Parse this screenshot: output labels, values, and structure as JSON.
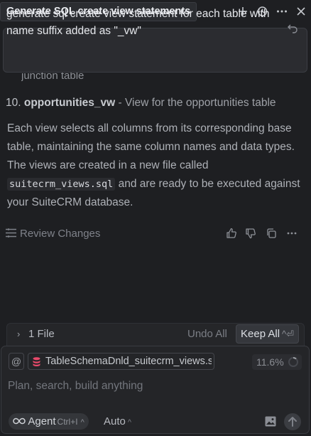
{
  "header": {
    "tab_title": "Generate SQL create view statements",
    "icons": [
      "plus-icon",
      "history-icon",
      "more-icon",
      "close-icon"
    ]
  },
  "prompt": {
    "text": "generate sql create view statement for each table with name suffix added as \"_vw\""
  },
  "transcript": {
    "cut_line": "junction table",
    "list_item": {
      "number": "10.",
      "name": "opportunities_vw",
      "description": " - View for the opportunities table"
    },
    "paragraph": {
      "part1": "Each view selects all columns from its corresponding base table, maintaining the same column names and data types. The views are created in a new file called ",
      "code": "suitecrm_views.sql",
      "part2": " and are ready to be executed against your SuiteCRM database."
    },
    "review_label": "Review Changes"
  },
  "files_bar": {
    "label": "1 File",
    "undo_all": "Undo All",
    "keep_all": "Keep All",
    "keep_all_shortcut": "^⏎"
  },
  "composer": {
    "at_symbol": "@",
    "context_file": "TableSchemaDnld_suitecrm_views.sql",
    "context_usage": "11.6%",
    "context_usage_fraction": 0.116,
    "placeholder": "Plan, search, build anything",
    "agent_label": "Agent",
    "agent_shortcut": "Ctrl+I",
    "model": "Auto"
  },
  "colors": {
    "background": "#1e1f22",
    "chip_icon": "#e8496a",
    "text_muted": "#9ea1a7"
  }
}
